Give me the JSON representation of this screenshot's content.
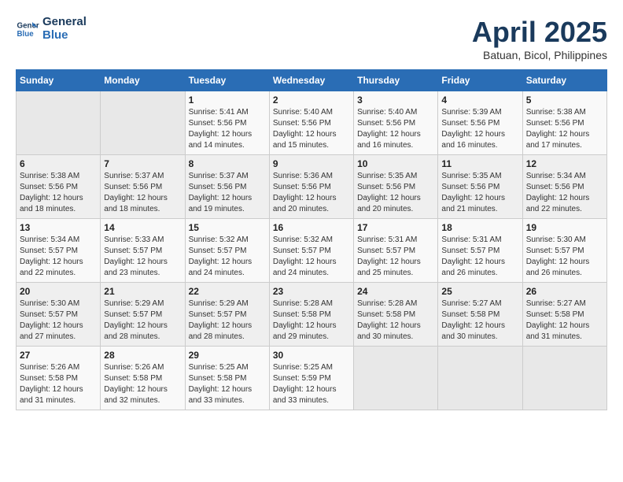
{
  "header": {
    "logo_line1": "General",
    "logo_line2": "Blue",
    "title": "April 2025",
    "subtitle": "Batuan, Bicol, Philippines"
  },
  "weekdays": [
    "Sunday",
    "Monday",
    "Tuesday",
    "Wednesday",
    "Thursday",
    "Friday",
    "Saturday"
  ],
  "weeks": [
    [
      {
        "day": "",
        "detail": ""
      },
      {
        "day": "",
        "detail": ""
      },
      {
        "day": "1",
        "detail": "Sunrise: 5:41 AM\nSunset: 5:56 PM\nDaylight: 12 hours and 14 minutes."
      },
      {
        "day": "2",
        "detail": "Sunrise: 5:40 AM\nSunset: 5:56 PM\nDaylight: 12 hours and 15 minutes."
      },
      {
        "day": "3",
        "detail": "Sunrise: 5:40 AM\nSunset: 5:56 PM\nDaylight: 12 hours and 16 minutes."
      },
      {
        "day": "4",
        "detail": "Sunrise: 5:39 AM\nSunset: 5:56 PM\nDaylight: 12 hours and 16 minutes."
      },
      {
        "day": "5",
        "detail": "Sunrise: 5:38 AM\nSunset: 5:56 PM\nDaylight: 12 hours and 17 minutes."
      }
    ],
    [
      {
        "day": "6",
        "detail": "Sunrise: 5:38 AM\nSunset: 5:56 PM\nDaylight: 12 hours and 18 minutes."
      },
      {
        "day": "7",
        "detail": "Sunrise: 5:37 AM\nSunset: 5:56 PM\nDaylight: 12 hours and 18 minutes."
      },
      {
        "day": "8",
        "detail": "Sunrise: 5:37 AM\nSunset: 5:56 PM\nDaylight: 12 hours and 19 minutes."
      },
      {
        "day": "9",
        "detail": "Sunrise: 5:36 AM\nSunset: 5:56 PM\nDaylight: 12 hours and 20 minutes."
      },
      {
        "day": "10",
        "detail": "Sunrise: 5:35 AM\nSunset: 5:56 PM\nDaylight: 12 hours and 20 minutes."
      },
      {
        "day": "11",
        "detail": "Sunrise: 5:35 AM\nSunset: 5:56 PM\nDaylight: 12 hours and 21 minutes."
      },
      {
        "day": "12",
        "detail": "Sunrise: 5:34 AM\nSunset: 5:56 PM\nDaylight: 12 hours and 22 minutes."
      }
    ],
    [
      {
        "day": "13",
        "detail": "Sunrise: 5:34 AM\nSunset: 5:57 PM\nDaylight: 12 hours and 22 minutes."
      },
      {
        "day": "14",
        "detail": "Sunrise: 5:33 AM\nSunset: 5:57 PM\nDaylight: 12 hours and 23 minutes."
      },
      {
        "day": "15",
        "detail": "Sunrise: 5:32 AM\nSunset: 5:57 PM\nDaylight: 12 hours and 24 minutes."
      },
      {
        "day": "16",
        "detail": "Sunrise: 5:32 AM\nSunset: 5:57 PM\nDaylight: 12 hours and 24 minutes."
      },
      {
        "day": "17",
        "detail": "Sunrise: 5:31 AM\nSunset: 5:57 PM\nDaylight: 12 hours and 25 minutes."
      },
      {
        "day": "18",
        "detail": "Sunrise: 5:31 AM\nSunset: 5:57 PM\nDaylight: 12 hours and 26 minutes."
      },
      {
        "day": "19",
        "detail": "Sunrise: 5:30 AM\nSunset: 5:57 PM\nDaylight: 12 hours and 26 minutes."
      }
    ],
    [
      {
        "day": "20",
        "detail": "Sunrise: 5:30 AM\nSunset: 5:57 PM\nDaylight: 12 hours and 27 minutes."
      },
      {
        "day": "21",
        "detail": "Sunrise: 5:29 AM\nSunset: 5:57 PM\nDaylight: 12 hours and 28 minutes."
      },
      {
        "day": "22",
        "detail": "Sunrise: 5:29 AM\nSunset: 5:57 PM\nDaylight: 12 hours and 28 minutes."
      },
      {
        "day": "23",
        "detail": "Sunrise: 5:28 AM\nSunset: 5:58 PM\nDaylight: 12 hours and 29 minutes."
      },
      {
        "day": "24",
        "detail": "Sunrise: 5:28 AM\nSunset: 5:58 PM\nDaylight: 12 hours and 30 minutes."
      },
      {
        "day": "25",
        "detail": "Sunrise: 5:27 AM\nSunset: 5:58 PM\nDaylight: 12 hours and 30 minutes."
      },
      {
        "day": "26",
        "detail": "Sunrise: 5:27 AM\nSunset: 5:58 PM\nDaylight: 12 hours and 31 minutes."
      }
    ],
    [
      {
        "day": "27",
        "detail": "Sunrise: 5:26 AM\nSunset: 5:58 PM\nDaylight: 12 hours and 31 minutes."
      },
      {
        "day": "28",
        "detail": "Sunrise: 5:26 AM\nSunset: 5:58 PM\nDaylight: 12 hours and 32 minutes."
      },
      {
        "day": "29",
        "detail": "Sunrise: 5:25 AM\nSunset: 5:58 PM\nDaylight: 12 hours and 33 minutes."
      },
      {
        "day": "30",
        "detail": "Sunrise: 5:25 AM\nSunset: 5:59 PM\nDaylight: 12 hours and 33 minutes."
      },
      {
        "day": "",
        "detail": ""
      },
      {
        "day": "",
        "detail": ""
      },
      {
        "day": "",
        "detail": ""
      }
    ]
  ]
}
